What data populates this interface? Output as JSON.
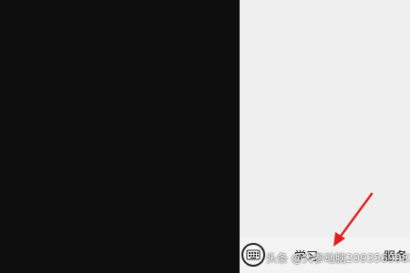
{
  "bottom_menu": {
    "items": [
      {
        "label": "学习"
      },
      {
        "label": "服务"
      }
    ],
    "keyboard_icon": "keyboard-icon"
  },
  "watermark": {
    "text": "头条 @大参动脑2093569983"
  },
  "annotation": {
    "arrow_color": "#e02020"
  }
}
